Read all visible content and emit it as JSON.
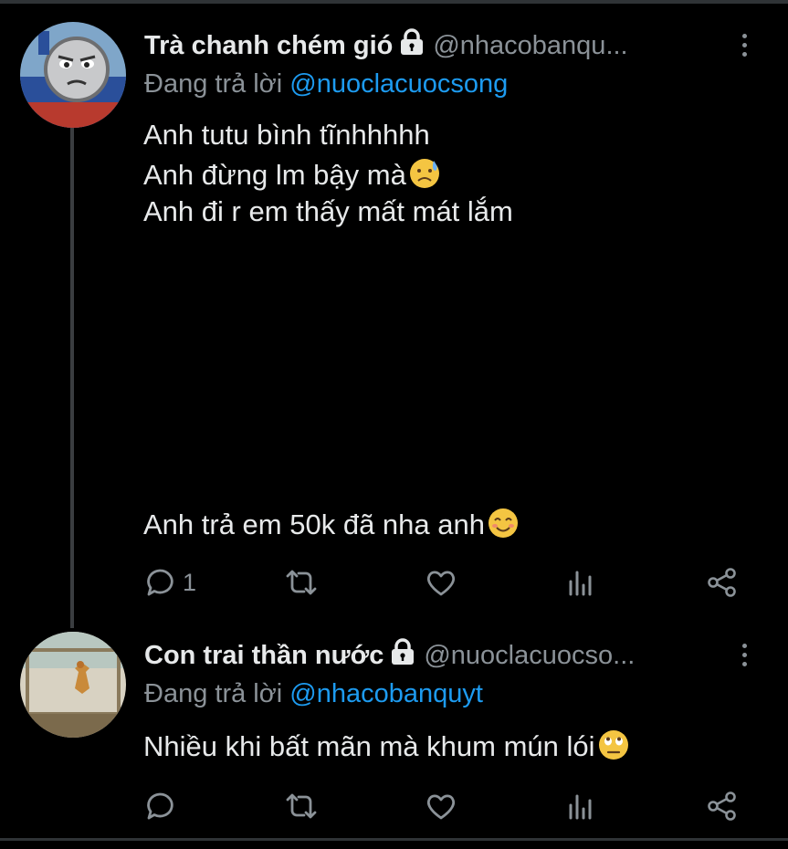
{
  "tweets": [
    {
      "display_name": "Trà chanh chém gió",
      "handle": "@nhacobanqu...",
      "reply_prefix": "Đang trả lời",
      "reply_to": "@nuoclacuocsong",
      "lines": [
        "Anh tutu bình tĩnhhhhh",
        "Anh đừng lm bậy mà",
        "Anh đi r em thấy mất mát lắm",
        "Anh trả em 50k đã nha anh"
      ],
      "reply_count": "1"
    },
    {
      "display_name": "Con trai thần nước",
      "handle": "@nuoclacuocso...",
      "reply_prefix": "Đang trả lời",
      "reply_to": "@nhacobanquyt",
      "lines": [
        "Nhiều khi bất mãn mà khum mún lói"
      ],
      "reply_count": ""
    }
  ],
  "icons": [
    "lock-icon",
    "more-icon",
    "reply-icon",
    "retweet-icon",
    "like-icon",
    "analytics-icon",
    "share-icon"
  ],
  "colors": {
    "background": "#000000",
    "text": "#e7e9ea",
    "secondary": "#8b9298",
    "accent": "#1d9bf0"
  }
}
